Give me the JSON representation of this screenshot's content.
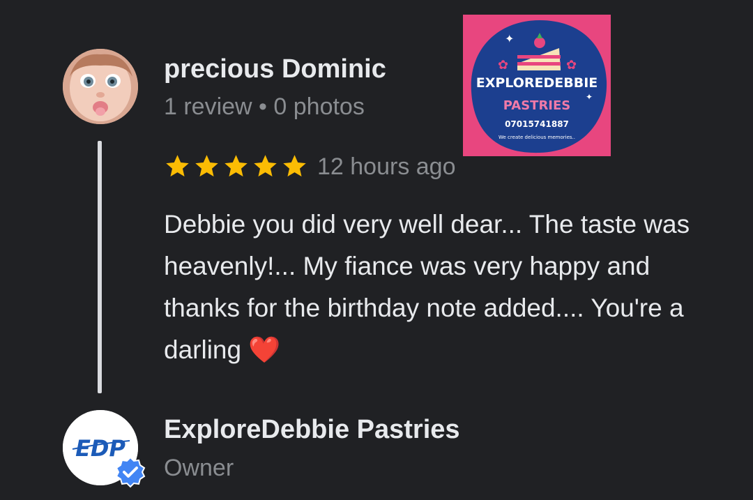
{
  "review": {
    "reviewer_name": "precious Dominic",
    "reviewer_meta": "1 review • 0 photos",
    "rating": 5,
    "time": "12 hours ago",
    "text": "Debbie you did very well dear... The taste was heavenly!... My fiance was very happy and thanks for the birthday note added.... You're a darling",
    "emoji": "❤️",
    "photo": {
      "brand": "EXPLOREDEBBIE",
      "sub": "PASTRIES",
      "phone": "07015741887",
      "tagline": "We create delicious memories.."
    }
  },
  "owner": {
    "name": "ExploreDebbie Pastries",
    "role": "Owner",
    "avatar_text": "EDP"
  },
  "colors": {
    "background": "#202124",
    "star": "#fbbc04",
    "verified": "#4285f4",
    "logo_pink": "#e8467f",
    "logo_blue": "#1c3f8f"
  },
  "icons": {
    "star": "star-icon",
    "verified": "verified-check-icon",
    "heart": "heart-emoji"
  }
}
